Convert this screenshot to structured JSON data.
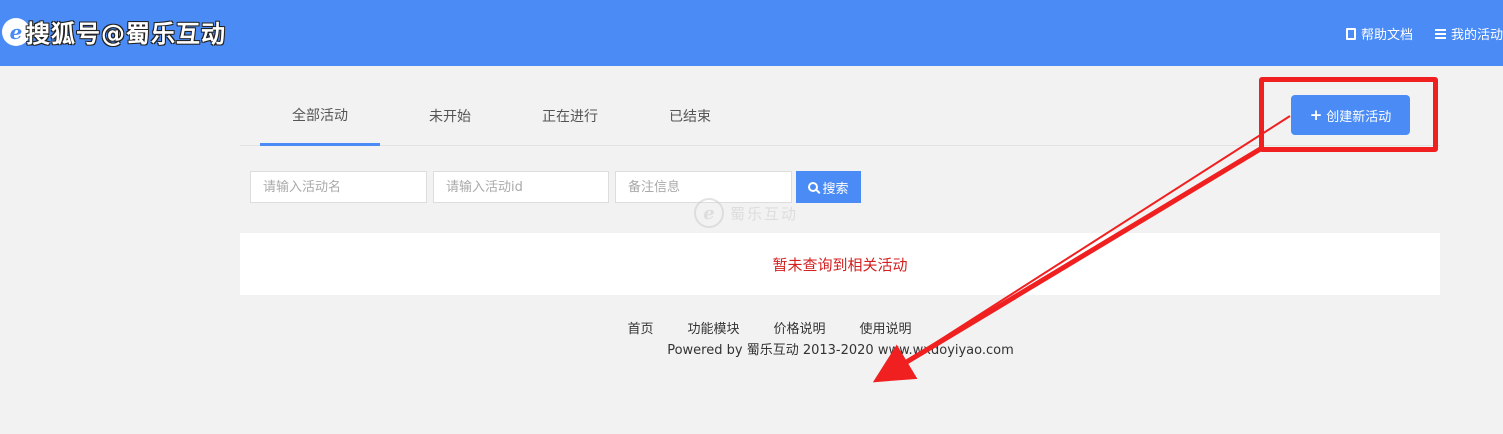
{
  "header": {
    "watermark": "搜狐号@蜀乐互动",
    "logo_letter": "e",
    "nav": [
      {
        "label": "帮助文档",
        "icon": "document-icon"
      },
      {
        "label": "我的活动",
        "icon": "list-icon"
      }
    ]
  },
  "tabs": [
    {
      "label": "全部活动",
      "active": true
    },
    {
      "label": "未开始",
      "active": false
    },
    {
      "label": "正在进行",
      "active": false
    },
    {
      "label": "已结束",
      "active": false
    }
  ],
  "create_button": {
    "label": "创建新活动",
    "icon": "plus-icon"
  },
  "search": {
    "name_placeholder": "请输入活动名",
    "id_placeholder": "请输入活动id",
    "note_placeholder": "备注信息",
    "button_label": "搜索"
  },
  "center_watermark": "蜀乐互动",
  "empty_message": "暂未查询到相关活动",
  "footer": {
    "links": [
      "首页",
      "功能模块",
      "价格说明",
      "使用说明"
    ],
    "copyright": "Powered by 蜀乐互动 2013-2020 www.wxdoyiyao.com"
  },
  "colors": {
    "accent": "#4a8bf5",
    "annotation": "#f02020",
    "empty_text": "#d42020"
  }
}
